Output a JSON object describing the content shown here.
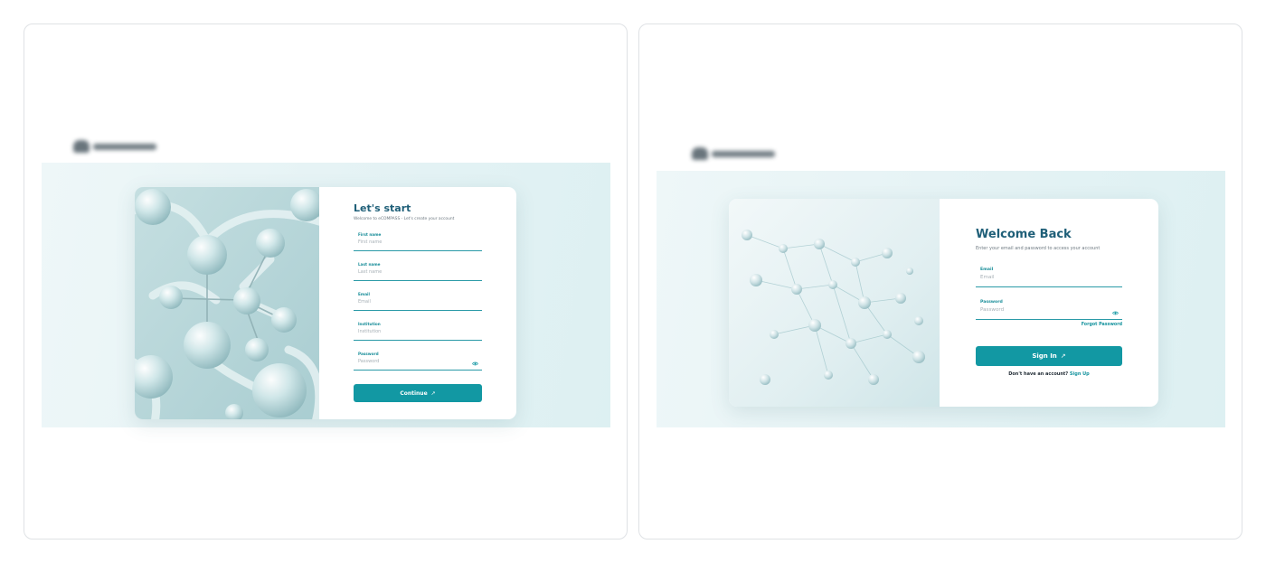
{
  "signup_screen": {
    "title": "Let's start",
    "subtitle": "Welcome to eCOMPASS - Let's create your account",
    "fields": [
      {
        "label": "First name",
        "placeholder": "First name"
      },
      {
        "label": "Last name",
        "placeholder": "Last name"
      },
      {
        "label": "Email",
        "placeholder": "Email"
      },
      {
        "label": "Institution",
        "placeholder": "Institution"
      },
      {
        "label": "Password",
        "placeholder": "Password"
      }
    ],
    "continue_label": "Continue",
    "continue_icon": "arrow-up-right-icon",
    "password_icon": "eye-icon"
  },
  "signin_screen": {
    "title": "Welcome Back",
    "subtitle": "Enter your email and password to access your account",
    "fields": [
      {
        "label": "Email",
        "placeholder": "Email"
      },
      {
        "label": "Password",
        "placeholder": "Password"
      }
    ],
    "forgot_label": "Forgot Password",
    "signin_label": "Sign In",
    "signin_icon": "arrow-up-right-icon",
    "no_account_text": "Don't have an account?",
    "signup_link": "Sign Up",
    "password_icon": "eye-icon"
  },
  "colors": {
    "accent": "#1298a3",
    "title": "#1f5f78",
    "background_band": "#e6f3f5"
  }
}
